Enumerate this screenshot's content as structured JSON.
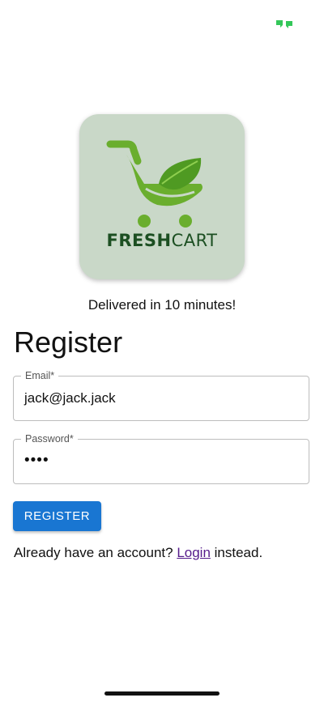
{
  "status_bar": {
    "icon": "chat-bubbles-icon",
    "icon_color": "#34c759"
  },
  "logo": {
    "brand_fresh": "FRESH",
    "brand_cart": "CART",
    "icon": "shopping-cart-leaf-icon",
    "colors": {
      "background": "#c9d8c8",
      "cart": "#6aae2e",
      "text": "#1c4f22"
    }
  },
  "tagline": "Delivered in 10 minutes!",
  "form": {
    "title": "Register",
    "email": {
      "label": "Email*",
      "value": "jack@jack.jack"
    },
    "password": {
      "label": "Password*",
      "value": "••••"
    },
    "submit_label": "REGISTER"
  },
  "footer": {
    "prefix": "Already have an account? ",
    "link_label": "Login",
    "suffix": " instead."
  },
  "colors": {
    "accent": "#1976d2",
    "link": "#551a8b"
  }
}
